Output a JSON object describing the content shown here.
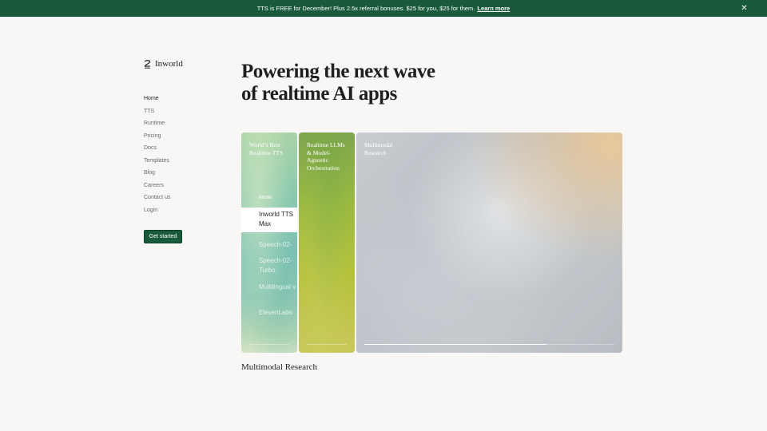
{
  "banner": {
    "text": "TTS is FREE for December! Plus 2.5x referral bonuses. $25 for you, $25 for them.",
    "link": "Learn more",
    "close_icon": "close-icon",
    "close_glyph": "✕"
  },
  "brand": {
    "name": "Inworld",
    "icon": "inworld-logo-icon"
  },
  "nav": {
    "items": [
      "Home",
      "TTS",
      "Runtime",
      "Pricing",
      "Docs",
      "Templates",
      "Blog",
      "Careers",
      "Contact us",
      "Login"
    ],
    "active": "Home",
    "cta": "Get started"
  },
  "hero": {
    "title_line1": "Powering the next wave",
    "title_line2": "of realtime AI apps"
  },
  "panels": [
    {
      "label": "World’s Best Realtime TTS",
      "model_caption": "Model",
      "models": [
        "Inworld TTS Max",
        "Speech-02-",
        "Speech-02-Turbo",
        "Multilingual v",
        "ElevenLabs"
      ],
      "selected_model": "Inworld TTS Max",
      "progress": 0
    },
    {
      "label": "Realtime LLMs & Model-Agnostic Orchestration",
      "progress": 0
    },
    {
      "label": "Multimodal Research",
      "progress": 0.73,
      "active": true
    }
  ],
  "active_caption": "Multimodal Research",
  "colors": {
    "brand_green": "#1a5a3c",
    "background": "#f8f7f5"
  }
}
